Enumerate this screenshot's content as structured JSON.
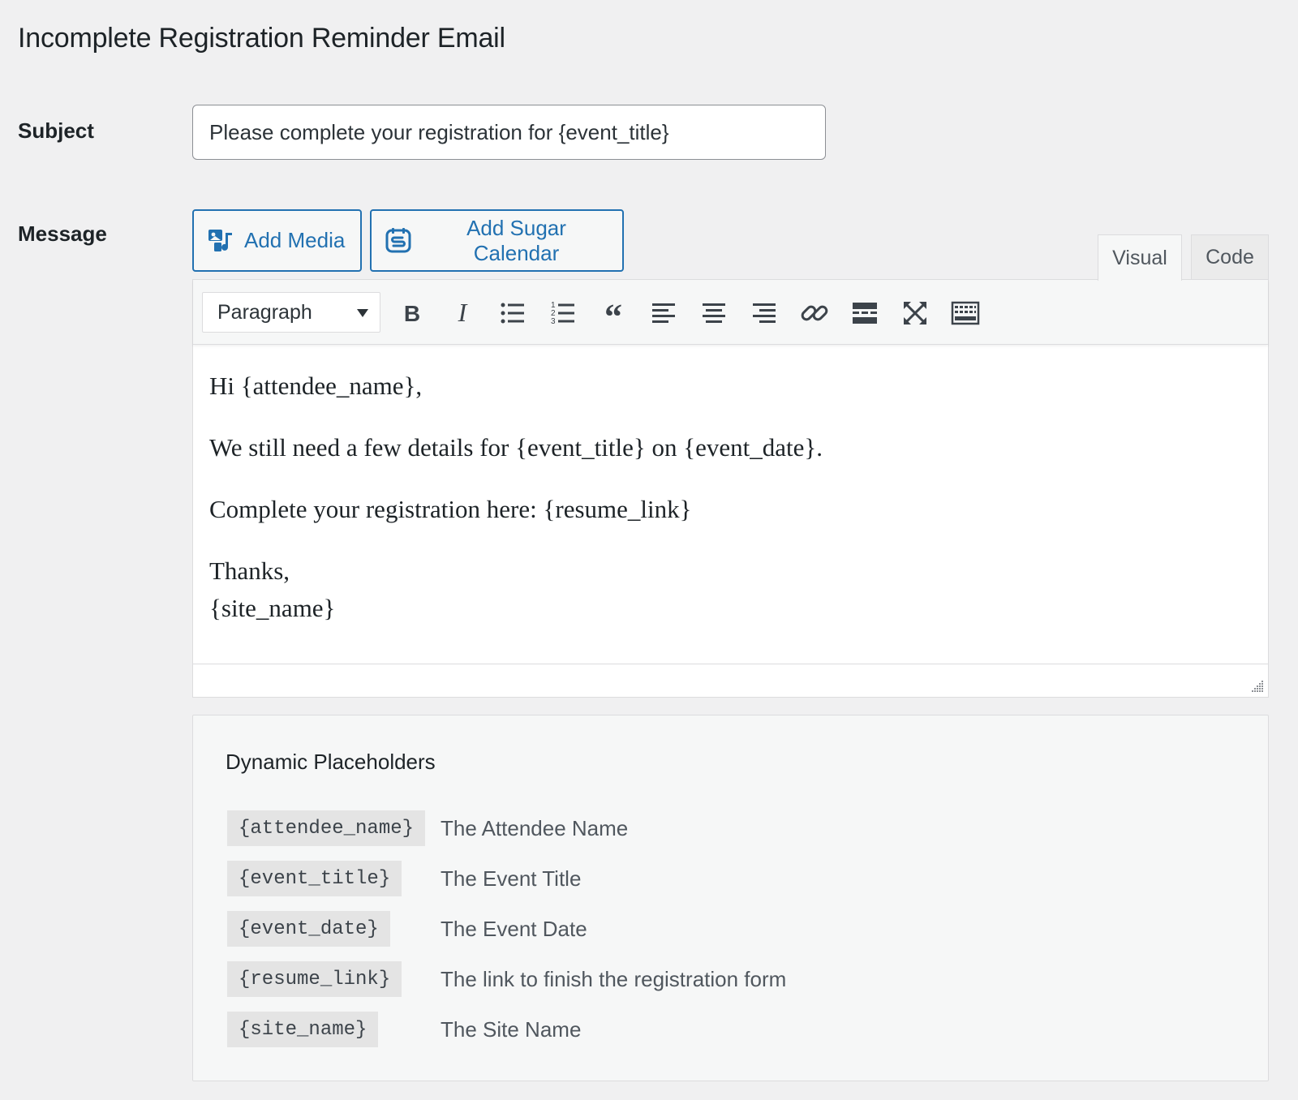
{
  "page": {
    "title": "Incomplete Registration Reminder Email"
  },
  "subject": {
    "label": "Subject",
    "value": "Please complete your registration for {event_title}"
  },
  "message": {
    "label": "Message",
    "add_media_label": "Add Media",
    "add_sugar_calendar_label": "Add Sugar Calendar",
    "tabs": {
      "visual": "Visual",
      "code": "Code"
    },
    "toolbar": {
      "format_value": "Paragraph"
    },
    "body": {
      "line1": "Hi {attendee_name},",
      "line2": "We still need a few details for {event_title} on {event_date}.",
      "line3": "Complete your registration here: {resume_link}",
      "line4": "Thanks,",
      "line5": "{site_name}"
    }
  },
  "placeholders": {
    "title": "Dynamic Placeholders",
    "items": [
      {
        "code": "{attendee_name}",
        "desc": "The Attendee Name"
      },
      {
        "code": "{event_title}",
        "desc": "The Event Title"
      },
      {
        "code": "{event_date}",
        "desc": "The Event Date"
      },
      {
        "code": "{resume_link}",
        "desc": "The link to finish the registration form"
      },
      {
        "code": "{site_name}",
        "desc": "The Site Name"
      }
    ]
  },
  "icons": {
    "add_media": "media-icon",
    "add_sugar_calendar": "calendar-icon",
    "bold": "bold-icon",
    "italic": "italic-icon",
    "bullet_list": "bullet-list-icon",
    "numbered_list": "numbered-list-icon",
    "blockquote": "blockquote-icon",
    "align_left": "align-left-icon",
    "align_center": "align-center-icon",
    "align_right": "align-right-icon",
    "link": "link-icon",
    "read_more": "read-more-icon",
    "fullscreen": "fullscreen-icon",
    "toolbar_toggle": "toolbar-toggle-icon"
  },
  "colors": {
    "accent": "#2271b1",
    "background": "#f0f0f1",
    "text": "#1d2327"
  }
}
